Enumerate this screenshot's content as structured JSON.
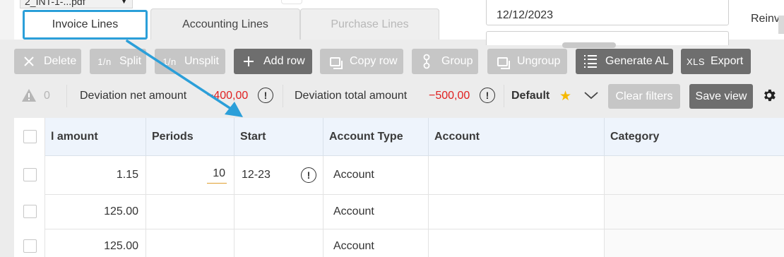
{
  "top": {
    "file_name": "2_INT-1-...pdf",
    "date_value": "12/12/2023",
    "side_label": "Reinvo"
  },
  "tabs": [
    {
      "label": "Invoice Lines",
      "state": "selected"
    },
    {
      "label": "Accounting Lines",
      "state": "normal"
    },
    {
      "label": "Purchase Lines",
      "state": "disabled"
    }
  ],
  "toolbar": {
    "delete": {
      "label": "Delete",
      "icon": "close-icon",
      "enabled": false
    },
    "split": {
      "label": "Split",
      "icon_text": "1/n",
      "enabled": false
    },
    "unsplit": {
      "label": "Unsplit",
      "icon_text": "1/n",
      "enabled": false
    },
    "add_row": {
      "label": "Add row",
      "icon": "plus-icon",
      "enabled": true
    },
    "copy_row": {
      "label": "Copy row",
      "icon": "copy-icon",
      "enabled": false
    },
    "group": {
      "label": "Group",
      "icon": "group-icon",
      "enabled": false
    },
    "ungroup": {
      "label": "Ungroup",
      "icon": "ungroup-icon",
      "enabled": false
    },
    "generate_al": {
      "label": "Generate AL",
      "icon": "list-icon",
      "enabled": true
    },
    "export": {
      "label": "Export",
      "icon_text": "XLS",
      "enabled": true
    }
  },
  "filters": {
    "warning_count": "0",
    "deviation_net_label": "Deviation net amount",
    "deviation_net_value": "−400,00",
    "deviation_total_label": "Deviation total amount",
    "deviation_total_value": "−500,00",
    "view_name": "Default",
    "clear_filters_label": "Clear filters",
    "save_view_label": "Save view"
  },
  "grid": {
    "columns": [
      "l amount",
      "Periods",
      "Start",
      "Account Type",
      "Account",
      "Category"
    ],
    "rows": [
      {
        "amount": "1.15",
        "periods": "10",
        "start": "12-23",
        "account_type": "Account",
        "account": "",
        "category": ""
      },
      {
        "amount": "125.00",
        "periods": "",
        "start": "",
        "account_type": "Account",
        "account": "",
        "category": ""
      },
      {
        "amount": "125.00",
        "periods": "",
        "start": "",
        "account_type": "Account",
        "account": "",
        "category": ""
      }
    ]
  },
  "colors": {
    "tab_highlight": "#2b9fd9",
    "arrow": "#2b9fd9",
    "negative_value": "#e02020",
    "star": "#f5b800",
    "button_active": "#6e6e6e",
    "button_disabled": "#c6c6c6",
    "header_bg": "#eef4fc",
    "period_underline": "#e0a030"
  }
}
